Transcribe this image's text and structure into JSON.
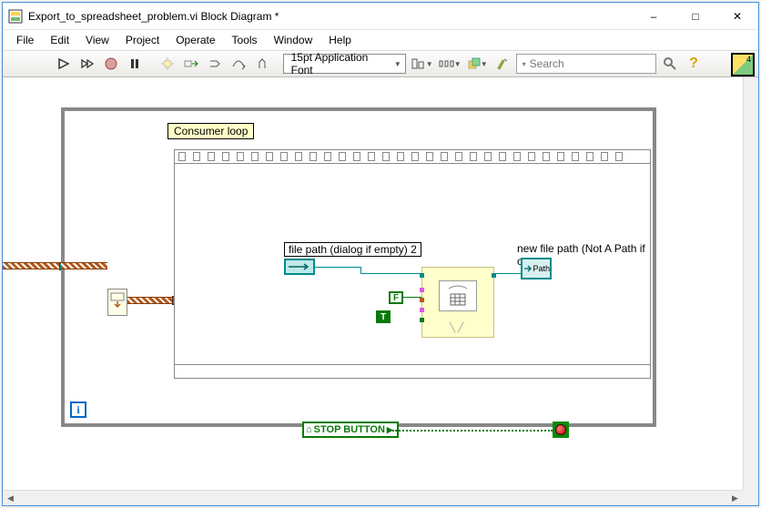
{
  "window": {
    "title": "Export_to_spreadsheet_problem.vi Block Diagram *"
  },
  "menu": [
    "File",
    "Edit",
    "View",
    "Project",
    "Operate",
    "Tools",
    "Window",
    "Help"
  ],
  "toolbar": {
    "font": "15pt Application Font",
    "search_placeholder": "Search",
    "vi_corner": "4"
  },
  "diagram": {
    "loop_label": "Consumer loop",
    "file_path_label": "file path (dialog if empty) 2",
    "new_file_path_label": "new file path (Not A Path if can",
    "path_ind_text": "Path",
    "bool_false": "F",
    "bool_true": "T",
    "stop_button_label": "STOP BUTTON",
    "iter_label": "i"
  }
}
